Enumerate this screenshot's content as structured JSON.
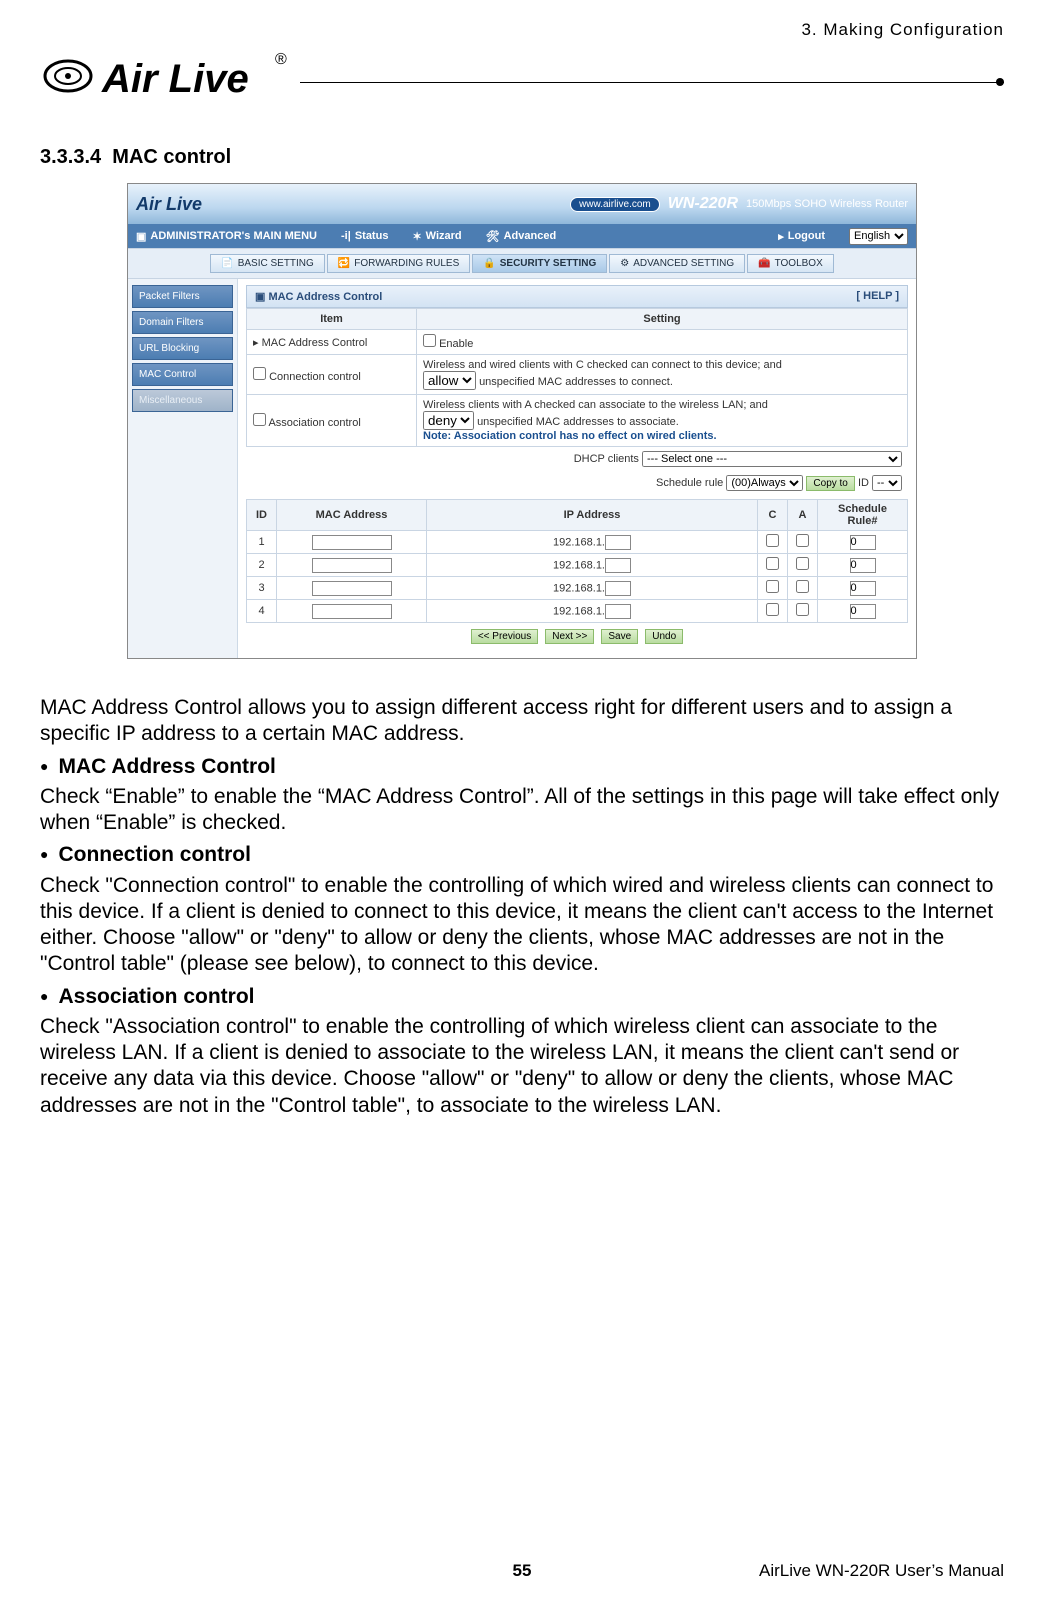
{
  "chapter_header": "3. Making Configuration",
  "section_number": "3.3.3.4",
  "section_title": "MAC control",
  "logo_text": "AirLive",
  "screenshot": {
    "banner": {
      "brand": "Air Live",
      "url_pill": "www.airlive.com",
      "model": "WN-220R",
      "model_sub": "150Mbps SOHO Wireless Router"
    },
    "menubar": {
      "admin": "ADMINISTRATOR's MAIN MENU",
      "status": "Status",
      "wizard": "Wizard",
      "advanced": "Advanced",
      "logout": "Logout",
      "lang": "English"
    },
    "toolbar": {
      "basic": "BASIC SETTING",
      "forwarding": "FORWARDING RULES",
      "security": "SECURITY SETTING",
      "advset": "ADVANCED SETTING",
      "toolbox": "TOOLBOX"
    },
    "sidenav": [
      "Packet Filters",
      "Domain Filters",
      "URL Blocking",
      "MAC Control",
      "Miscellaneous"
    ],
    "panel": {
      "title": "MAC Address Control",
      "help": "[ HELP ]",
      "head_item": "Item",
      "head_setting": "Setting",
      "row1_item": "MAC Address Control",
      "row1_setting": "Enable",
      "row2_item": "Connection control",
      "row2_line1": "Wireless and wired clients with C checked can connect to this device; and",
      "row2_select": "allow",
      "row2_line2": "unspecified MAC addresses to connect.",
      "row3_item": "Association control",
      "row3_line1": "Wireless clients with A checked can associate to the wireless LAN; and",
      "row3_select": "deny",
      "row3_line2": "unspecified MAC addresses to associate.",
      "row3_note": "Note: Association control has no effect on wired clients.",
      "dhcp_label": "DHCP clients",
      "dhcp_select": "--- Select one ---",
      "sched_label": "Schedule rule",
      "sched_select": "(00)Always",
      "copyto_btn": "Copy to",
      "id_label": "ID",
      "id_select": "--"
    },
    "grid": {
      "cols": [
        "ID",
        "MAC Address",
        "IP Address",
        "C",
        "A",
        "Schedule Rule#"
      ],
      "ip_prefix": "192.168.1.",
      "rows": [
        {
          "id": "1",
          "sched": "0"
        },
        {
          "id": "2",
          "sched": "0"
        },
        {
          "id": "3",
          "sched": "0"
        },
        {
          "id": "4",
          "sched": "0"
        }
      ]
    },
    "actions": {
      "prev": "<< Previous",
      "next": "Next >>",
      "save": "Save",
      "undo": "Undo"
    }
  },
  "body": {
    "intro": "MAC Address Control allows you to assign different access right for different users and to assign a specific IP address to a certain MAC address.",
    "h1": "MAC Address Control",
    "p1": "Check “Enable” to enable the “MAC Address Control”. All of the settings in this page will take effect only when “Enable” is checked.",
    "h2": "Connection control",
    "p2": "Check \"Connection control\" to enable the controlling of which wired and wireless clients can connect to this device. If a client is denied to connect to this device, it means the client can't access to the Internet either. Choose \"allow\" or \"deny\" to allow or deny the clients, whose MAC addresses are not in the \"Control table\" (please see below), to connect to this device.",
    "h3": "Association control",
    "p3": "Check \"Association control\" to enable the controlling of which wireless client can associate to the wireless LAN. If a client is denied to associate to the wireless LAN, it means the client can't send or receive any data via this device. Choose \"allow\" or \"deny\" to allow or deny the clients, whose MAC addresses are not in the \"Control table\", to associate to the wireless LAN."
  },
  "footer": {
    "page": "55",
    "manual": "AirLive WN-220R User’s Manual"
  }
}
